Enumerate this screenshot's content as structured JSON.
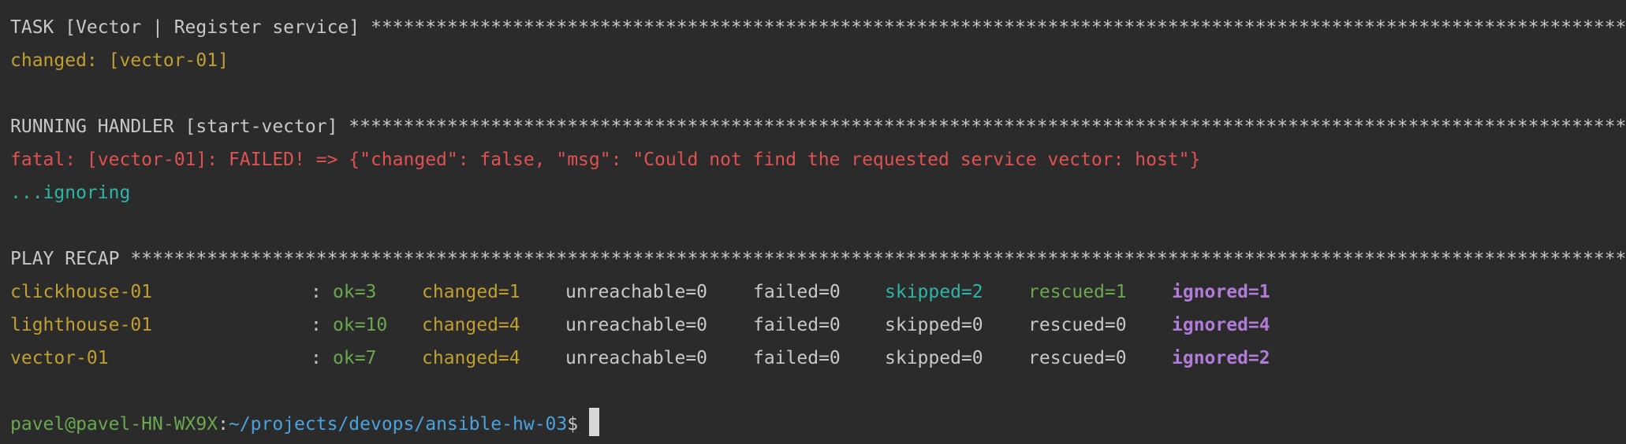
{
  "task_header": {
    "label": "TASK [Vector | Register service] ",
    "stars": "**************************************************************************************************************************************************************************************"
  },
  "task_result": "changed: [vector-01]",
  "handler_header": {
    "label": "RUNNING HANDLER [start-vector] ",
    "stars": "**************************************************************************************************************************************************************************************"
  },
  "handler_error": "fatal: [vector-01]: FAILED! => {\"changed\": false, \"msg\": \"Could not find the requested service vector: host\"}",
  "handler_ignoring": "...ignoring",
  "recap_header": {
    "label": "PLAY RECAP ",
    "stars": "**************************************************************************************************************************************************************************************************"
  },
  "recap": [
    {
      "host": "clickhouse-01",
      "colon": ":",
      "ok": "ok=3",
      "changed": "changed=1",
      "unreachable": "unreachable=0",
      "failed": "failed=0",
      "skipped": "skipped=2",
      "rescued": "rescued=1",
      "ignored": "ignored=1"
    },
    {
      "host": "lighthouse-01",
      "colon": ":",
      "ok": "ok=10",
      "changed": "changed=4",
      "unreachable": "unreachable=0",
      "failed": "failed=0",
      "skipped": "skipped=0",
      "rescued": "rescued=0",
      "ignored": "ignored=4"
    },
    {
      "host": "vector-01",
      "colon": ":",
      "ok": "ok=7",
      "changed": "changed=4",
      "unreachable": "unreachable=0",
      "failed": "failed=0",
      "skipped": "skipped=0",
      "rescued": "rescued=0",
      "ignored": "ignored=2"
    }
  ],
  "prompt": {
    "user_host": "pavel@pavel-HN-WX9X",
    "separator": ":",
    "path": "~/projects/devops/ansible-hw-03",
    "symbol": "$"
  },
  "colors": {
    "background": "#2b2b2b",
    "default_text": "#c8c8c8",
    "yellow": "#c0a030",
    "red": "#e05252",
    "cyan": "#2fb5a8",
    "green": "#6aa84f",
    "purple": "#b07cd8",
    "blue": "#4aa3df"
  }
}
